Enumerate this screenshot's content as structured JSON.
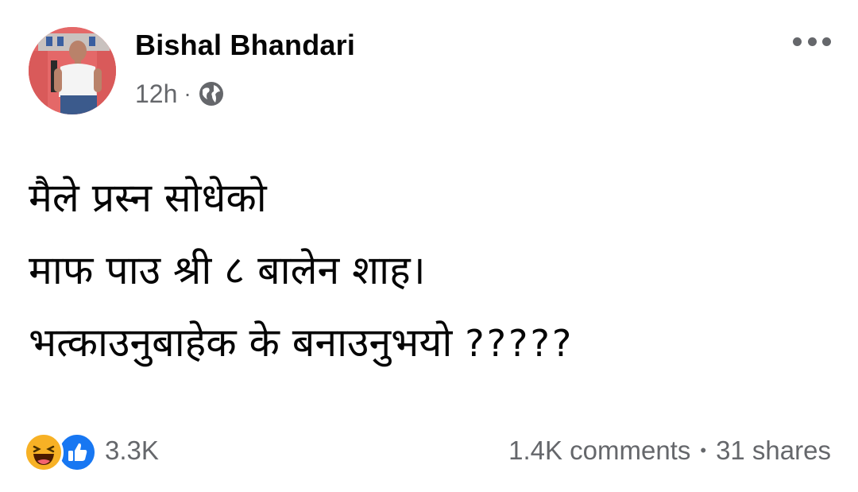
{
  "post": {
    "author": "Bishal Bhandari",
    "time": "12h",
    "meta_separator": "·",
    "privacy_icon": "globe-icon",
    "more_icon": "more-options-icon",
    "text_lines": [
      "मैले प्रस्न सोधेको",
      "माफ पाउ श्री ८ बालेन शाह।",
      "भत्काउनुबाहेक के बनाउनुभयो"
    ],
    "question_marks": "?????",
    "reactions": {
      "icons": [
        "haha-reaction-icon",
        "like-reaction-icon"
      ],
      "count": "3.3K"
    },
    "comments": "1.4K comments",
    "stats_separator": "•",
    "shares": "31 shares"
  },
  "colors": {
    "secondary_text": "#65676b",
    "like_blue": "#1877f2",
    "haha_yellow": "#f7b125",
    "avatar_bg": "#e66a6a"
  }
}
